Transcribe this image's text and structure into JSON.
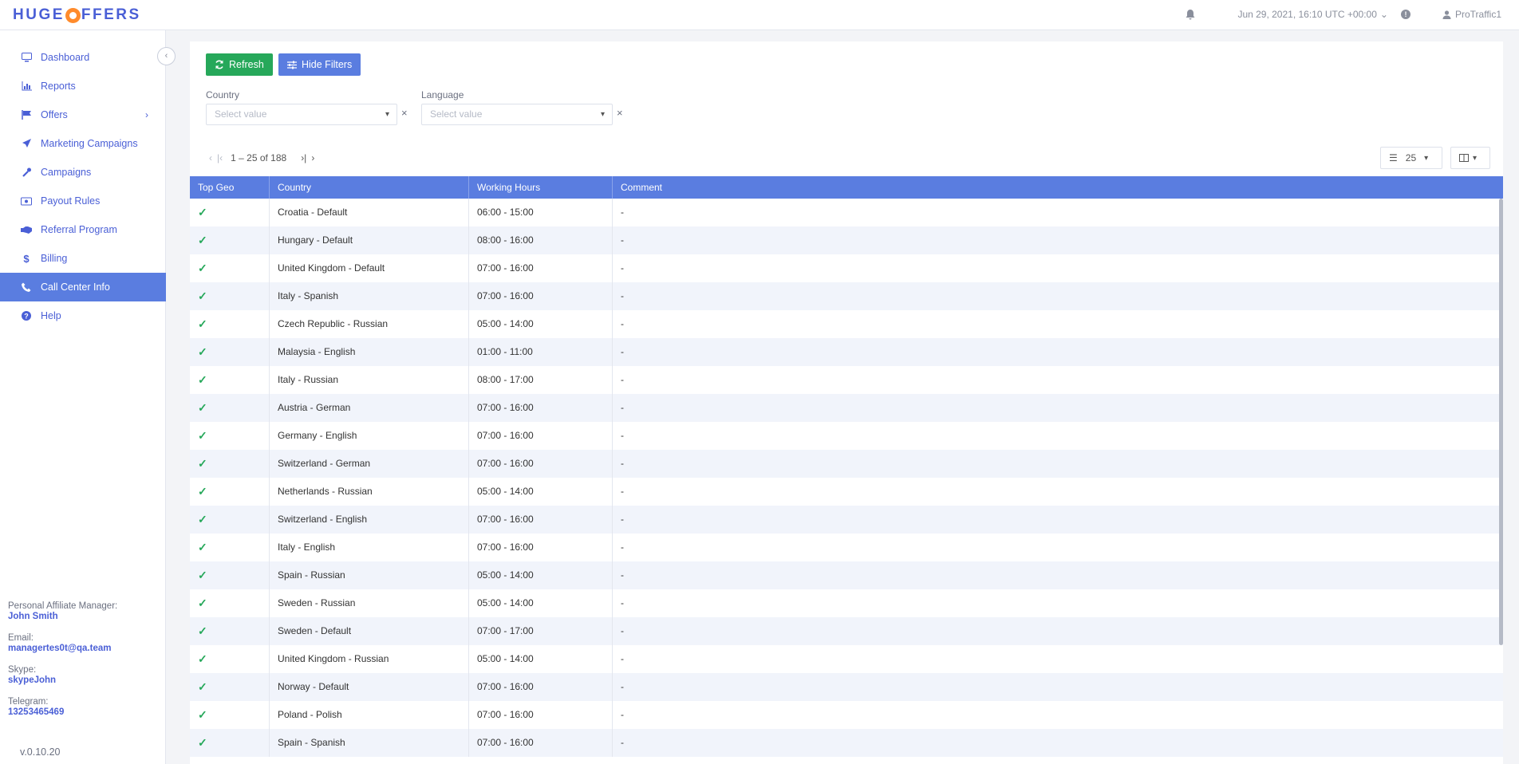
{
  "header": {
    "logo_text": "HUGEOFFERS",
    "datetime": "Jun 29, 2021, 16:10 UTC +00:00",
    "username": "ProTraffic1"
  },
  "sidebar": {
    "items": [
      {
        "label": "Dashboard",
        "icon": "monitor-icon"
      },
      {
        "label": "Reports",
        "icon": "bar-chart-icon"
      },
      {
        "label": "Offers",
        "icon": "flag-icon"
      },
      {
        "label": "Marketing Campaigns",
        "icon": "rocket-icon"
      },
      {
        "label": "Campaigns",
        "icon": "wrench-icon"
      },
      {
        "label": "Payout Rules",
        "icon": "money-icon"
      },
      {
        "label": "Referral Program",
        "icon": "handshake-icon"
      },
      {
        "label": "Billing",
        "icon": "dollar-icon"
      },
      {
        "label": "Call Center Info",
        "icon": "phone-icon"
      },
      {
        "label": "Help",
        "icon": "question-icon"
      }
    ],
    "manager": {
      "label": "Personal Affiliate Manager:",
      "name": "John Smith",
      "email_label": "Email:",
      "email": "managertes0t@qa.team",
      "skype_label": "Skype:",
      "skype": "skypeJohn",
      "telegram_label": "Telegram:",
      "telegram": "13253465469"
    },
    "version": "v.0.10.20"
  },
  "toolbar": {
    "refresh_label": "Refresh",
    "hide_filters_label": "Hide Filters"
  },
  "filters": {
    "country_label": "Country",
    "language_label": "Language",
    "placeholder": "Select value"
  },
  "pagination": {
    "range": "1 – 25 of 188",
    "per_page": "25"
  },
  "table": {
    "headers": [
      "Top Geo",
      "Country",
      "Working Hours",
      "Comment"
    ],
    "rows": [
      [
        "Croatia - Default",
        "06:00 - 15:00",
        "-"
      ],
      [
        "Hungary - Default",
        "08:00 - 16:00",
        "-"
      ],
      [
        "United Kingdom - Default",
        "07:00 - 16:00",
        "-"
      ],
      [
        "Italy - Spanish",
        "07:00 - 16:00",
        "-"
      ],
      [
        "Czech Republic - Russian",
        "05:00 - 14:00",
        "-"
      ],
      [
        "Malaysia - English",
        "01:00 - 11:00",
        "-"
      ],
      [
        "Italy - Russian",
        "08:00 - 17:00",
        "-"
      ],
      [
        "Austria - German",
        "07:00 - 16:00",
        "-"
      ],
      [
        "Germany - English",
        "07:00 - 16:00",
        "-"
      ],
      [
        "Switzerland - German",
        "07:00 - 16:00",
        "-"
      ],
      [
        "Netherlands - Russian",
        "05:00 - 14:00",
        "-"
      ],
      [
        "Switzerland - English",
        "07:00 - 16:00",
        "-"
      ],
      [
        "Italy - English",
        "07:00 - 16:00",
        "-"
      ],
      [
        "Spain - Russian",
        "05:00 - 14:00",
        "-"
      ],
      [
        "Sweden - Russian",
        "05:00 - 14:00",
        "-"
      ],
      [
        "Sweden - Default",
        "07:00 - 17:00",
        "-"
      ],
      [
        "United Kingdom - Russian",
        "05:00 - 14:00",
        "-"
      ],
      [
        "Norway - Default",
        "07:00 - 16:00",
        "-"
      ],
      [
        "Poland - Polish",
        "07:00 - 16:00",
        "-"
      ],
      [
        "Spain - Spanish",
        "07:00 - 16:00",
        "-"
      ]
    ]
  }
}
